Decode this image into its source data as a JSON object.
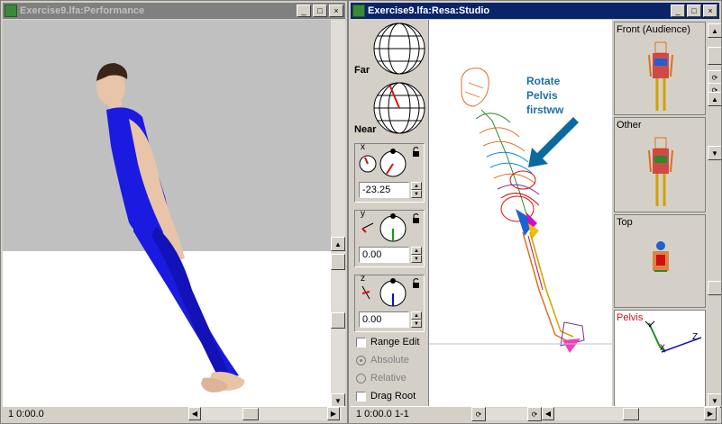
{
  "left_window": {
    "title": "Exercise9.lfa:Performance",
    "status": "1 0:00.0",
    "controls": {
      "minimize": "_",
      "maximize": "□",
      "close": "×"
    }
  },
  "right_window": {
    "title": "Exercise9.lfa:Resa:Studio",
    "status": "1 0:00.0 1-1",
    "controls": {
      "minimize": "_",
      "maximize": "□",
      "close": "×"
    },
    "sphere_labels": {
      "far": "Far",
      "near": "Near"
    },
    "axes": [
      {
        "axis": "x",
        "value": "-23.25",
        "color": "#d01010"
      },
      {
        "axis": "y",
        "value": "0.00",
        "color": "#10a010"
      },
      {
        "axis": "z",
        "value": "0.00",
        "color": "#1010c0"
      }
    ],
    "options": {
      "range_edit": "Range Edit",
      "absolute": "Absolute",
      "relative": "Relative",
      "drag_root": "Drag Root"
    },
    "annotation": {
      "line1": "Rotate",
      "line2": "Pelvis",
      "line3": "firstww",
      "color": "#1f6fa3"
    },
    "views": [
      {
        "label": "Front (Audience)"
      },
      {
        "label": "Other"
      },
      {
        "label": "Top"
      },
      {
        "label": "Pelvis",
        "color": "#d01010"
      }
    ]
  }
}
